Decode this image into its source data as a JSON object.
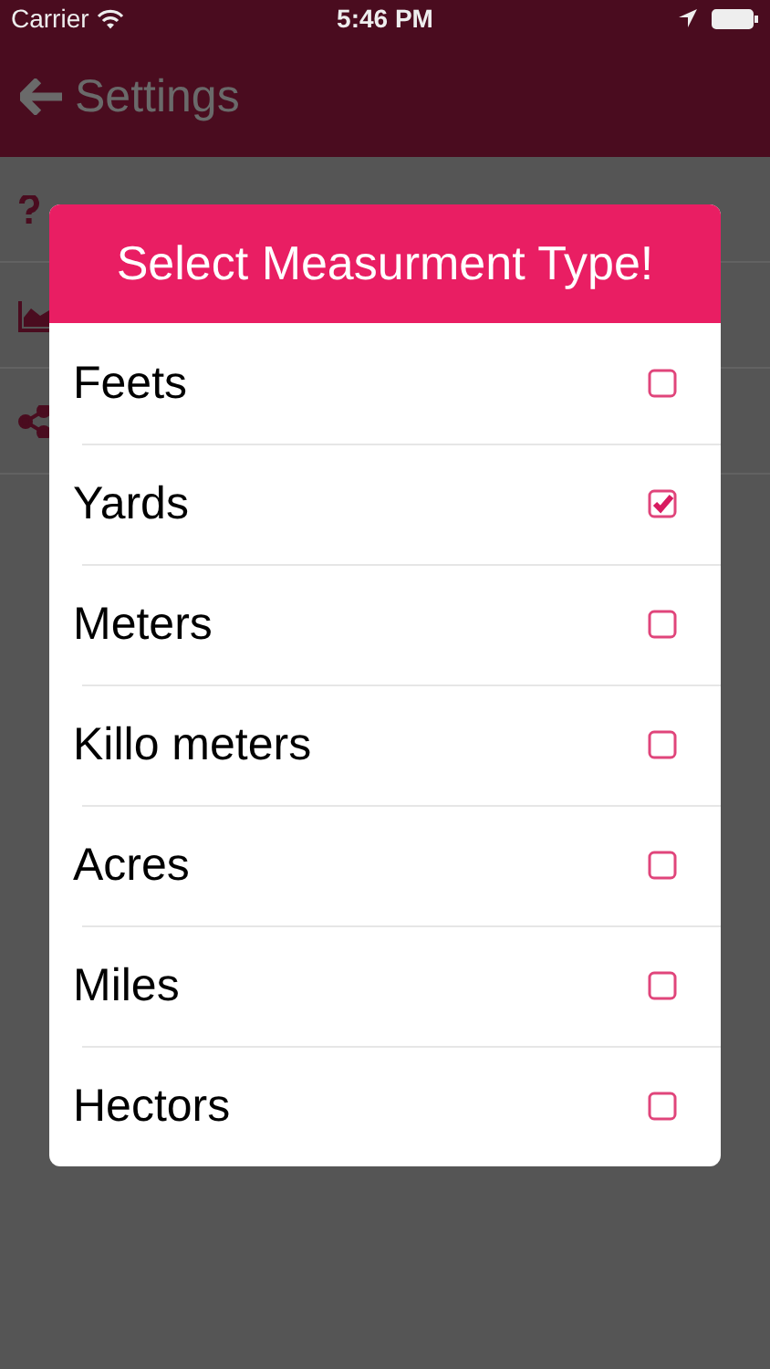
{
  "status_bar": {
    "carrier": "Carrier",
    "time": "5:46 PM"
  },
  "nav_bar": {
    "title": "Settings"
  },
  "background_rows": [
    {
      "kind": "help"
    },
    {
      "kind": "chart"
    },
    {
      "kind": "share"
    }
  ],
  "dialog": {
    "title": "Select Measurment Type!",
    "options": [
      {
        "label": "Feets",
        "checked": false
      },
      {
        "label": "Yards",
        "checked": true
      },
      {
        "label": "Meters",
        "checked": false
      },
      {
        "label": "Killo meters",
        "checked": false
      },
      {
        "label": "Acres",
        "checked": false
      },
      {
        "label": "Miles",
        "checked": false
      },
      {
        "label": "Hectors",
        "checked": false
      }
    ]
  }
}
